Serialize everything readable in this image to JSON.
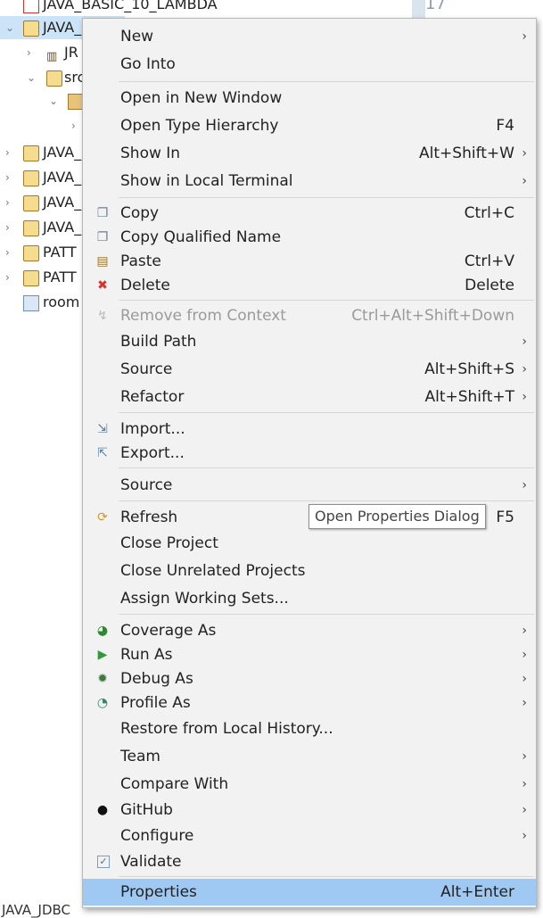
{
  "tree": {
    "items": [
      {
        "label": "JAVA_BASIC_10_LAMBDA"
      },
      {
        "label": "JAVA_"
      },
      {
        "label": "JR"
      },
      {
        "label": "src"
      },
      {
        "label": ""
      },
      {
        "label": ""
      },
      {
        "label": "JAVA_"
      },
      {
        "label": "JAVA_"
      },
      {
        "label": "JAVA_"
      },
      {
        "label": "JAVA_"
      },
      {
        "label": "PATT"
      },
      {
        "label": "PATT"
      },
      {
        "label": "room"
      }
    ],
    "status_label": "JAVA_JDBC"
  },
  "editor": {
    "line_number": "17"
  },
  "menu": {
    "items": [
      {
        "label": "New",
        "shortcut": "",
        "submenu": true
      },
      {
        "label": "Go Into",
        "shortcut": ""
      },
      {
        "label": "Open in New Window",
        "shortcut": ""
      },
      {
        "label": "Open Type Hierarchy",
        "shortcut": "F4"
      },
      {
        "label": "Show In",
        "shortcut": "Alt+Shift+W",
        "submenu": true
      },
      {
        "label": "Show in Local Terminal",
        "shortcut": "",
        "submenu": true
      },
      {
        "label": "Copy",
        "shortcut": "Ctrl+C",
        "icon": "copy-icon"
      },
      {
        "label": "Copy Qualified Name",
        "shortcut": "",
        "icon": "copy-qualified-icon"
      },
      {
        "label": "Paste",
        "shortcut": "Ctrl+V",
        "icon": "paste-icon"
      },
      {
        "label": "Delete",
        "shortcut": "Delete",
        "icon": "delete-icon"
      },
      {
        "label": "Remove from Context",
        "shortcut": "Ctrl+Alt+Shift+Down",
        "disabled": true,
        "icon": "remove-context-icon"
      },
      {
        "label": "Build Path",
        "shortcut": "",
        "submenu": true
      },
      {
        "label": "Source",
        "shortcut": "Alt+Shift+S",
        "submenu": true
      },
      {
        "label": "Refactor",
        "shortcut": "Alt+Shift+T",
        "submenu": true
      },
      {
        "label": "Import...",
        "shortcut": "",
        "icon": "import-icon"
      },
      {
        "label": "Export...",
        "shortcut": "",
        "icon": "export-icon"
      },
      {
        "label": "Source",
        "shortcut": "",
        "submenu": true
      },
      {
        "label": "Refresh",
        "shortcut": "F5",
        "icon": "refresh-icon"
      },
      {
        "label": "Close Project",
        "shortcut": ""
      },
      {
        "label": "Close Unrelated Projects",
        "shortcut": ""
      },
      {
        "label": "Assign Working Sets...",
        "shortcut": ""
      },
      {
        "label": "Coverage As",
        "shortcut": "",
        "submenu": true,
        "icon": "coverage-icon"
      },
      {
        "label": "Run As",
        "shortcut": "",
        "submenu": true,
        "icon": "run-icon"
      },
      {
        "label": "Debug As",
        "shortcut": "",
        "submenu": true,
        "icon": "debug-icon"
      },
      {
        "label": "Profile As",
        "shortcut": "",
        "submenu": true,
        "icon": "profile-icon"
      },
      {
        "label": "Restore from Local History...",
        "shortcut": ""
      },
      {
        "label": "Team",
        "shortcut": "",
        "submenu": true
      },
      {
        "label": "Compare With",
        "shortcut": "",
        "submenu": true
      },
      {
        "label": "GitHub",
        "shortcut": "",
        "submenu": true,
        "icon": "github-icon"
      },
      {
        "label": "Configure",
        "shortcut": "",
        "submenu": true
      },
      {
        "label": "Validate",
        "shortcut": "",
        "icon": "validate-checkbox-icon"
      },
      {
        "label": "Properties",
        "shortcut": "Alt+Enter",
        "highlighted": true
      }
    ]
  },
  "tooltip": {
    "text": "Open Properties Dialog"
  },
  "colors": {
    "highlight": "#9fc9f2",
    "selection": "#cce4f7",
    "menu_bg": "#f2f2f2"
  }
}
